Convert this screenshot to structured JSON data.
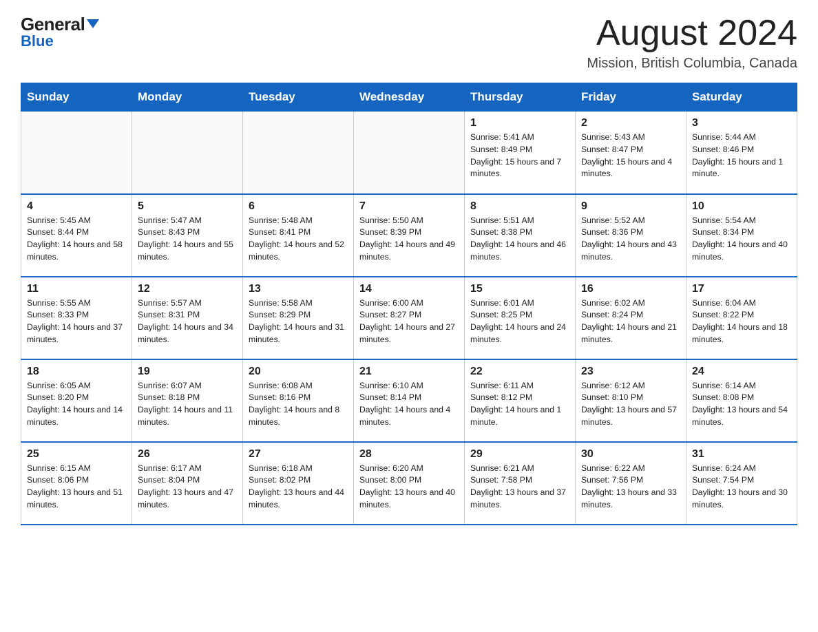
{
  "logo": {
    "top_text": "General",
    "triangle": "▲",
    "bottom_text": "Blue"
  },
  "header": {
    "month_year": "August 2024",
    "location": "Mission, British Columbia, Canada"
  },
  "days_of_week": [
    "Sunday",
    "Monday",
    "Tuesday",
    "Wednesday",
    "Thursday",
    "Friday",
    "Saturday"
  ],
  "weeks": [
    [
      {
        "day": "",
        "info": ""
      },
      {
        "day": "",
        "info": ""
      },
      {
        "day": "",
        "info": ""
      },
      {
        "day": "",
        "info": ""
      },
      {
        "day": "1",
        "info": "Sunrise: 5:41 AM\nSunset: 8:49 PM\nDaylight: 15 hours and 7 minutes."
      },
      {
        "day": "2",
        "info": "Sunrise: 5:43 AM\nSunset: 8:47 PM\nDaylight: 15 hours and 4 minutes."
      },
      {
        "day": "3",
        "info": "Sunrise: 5:44 AM\nSunset: 8:46 PM\nDaylight: 15 hours and 1 minute."
      }
    ],
    [
      {
        "day": "4",
        "info": "Sunrise: 5:45 AM\nSunset: 8:44 PM\nDaylight: 14 hours and 58 minutes."
      },
      {
        "day": "5",
        "info": "Sunrise: 5:47 AM\nSunset: 8:43 PM\nDaylight: 14 hours and 55 minutes."
      },
      {
        "day": "6",
        "info": "Sunrise: 5:48 AM\nSunset: 8:41 PM\nDaylight: 14 hours and 52 minutes."
      },
      {
        "day": "7",
        "info": "Sunrise: 5:50 AM\nSunset: 8:39 PM\nDaylight: 14 hours and 49 minutes."
      },
      {
        "day": "8",
        "info": "Sunrise: 5:51 AM\nSunset: 8:38 PM\nDaylight: 14 hours and 46 minutes."
      },
      {
        "day": "9",
        "info": "Sunrise: 5:52 AM\nSunset: 8:36 PM\nDaylight: 14 hours and 43 minutes."
      },
      {
        "day": "10",
        "info": "Sunrise: 5:54 AM\nSunset: 8:34 PM\nDaylight: 14 hours and 40 minutes."
      }
    ],
    [
      {
        "day": "11",
        "info": "Sunrise: 5:55 AM\nSunset: 8:33 PM\nDaylight: 14 hours and 37 minutes."
      },
      {
        "day": "12",
        "info": "Sunrise: 5:57 AM\nSunset: 8:31 PM\nDaylight: 14 hours and 34 minutes."
      },
      {
        "day": "13",
        "info": "Sunrise: 5:58 AM\nSunset: 8:29 PM\nDaylight: 14 hours and 31 minutes."
      },
      {
        "day": "14",
        "info": "Sunrise: 6:00 AM\nSunset: 8:27 PM\nDaylight: 14 hours and 27 minutes."
      },
      {
        "day": "15",
        "info": "Sunrise: 6:01 AM\nSunset: 8:25 PM\nDaylight: 14 hours and 24 minutes."
      },
      {
        "day": "16",
        "info": "Sunrise: 6:02 AM\nSunset: 8:24 PM\nDaylight: 14 hours and 21 minutes."
      },
      {
        "day": "17",
        "info": "Sunrise: 6:04 AM\nSunset: 8:22 PM\nDaylight: 14 hours and 18 minutes."
      }
    ],
    [
      {
        "day": "18",
        "info": "Sunrise: 6:05 AM\nSunset: 8:20 PM\nDaylight: 14 hours and 14 minutes."
      },
      {
        "day": "19",
        "info": "Sunrise: 6:07 AM\nSunset: 8:18 PM\nDaylight: 14 hours and 11 minutes."
      },
      {
        "day": "20",
        "info": "Sunrise: 6:08 AM\nSunset: 8:16 PM\nDaylight: 14 hours and 8 minutes."
      },
      {
        "day": "21",
        "info": "Sunrise: 6:10 AM\nSunset: 8:14 PM\nDaylight: 14 hours and 4 minutes."
      },
      {
        "day": "22",
        "info": "Sunrise: 6:11 AM\nSunset: 8:12 PM\nDaylight: 14 hours and 1 minute."
      },
      {
        "day": "23",
        "info": "Sunrise: 6:12 AM\nSunset: 8:10 PM\nDaylight: 13 hours and 57 minutes."
      },
      {
        "day": "24",
        "info": "Sunrise: 6:14 AM\nSunset: 8:08 PM\nDaylight: 13 hours and 54 minutes."
      }
    ],
    [
      {
        "day": "25",
        "info": "Sunrise: 6:15 AM\nSunset: 8:06 PM\nDaylight: 13 hours and 51 minutes."
      },
      {
        "day": "26",
        "info": "Sunrise: 6:17 AM\nSunset: 8:04 PM\nDaylight: 13 hours and 47 minutes."
      },
      {
        "day": "27",
        "info": "Sunrise: 6:18 AM\nSunset: 8:02 PM\nDaylight: 13 hours and 44 minutes."
      },
      {
        "day": "28",
        "info": "Sunrise: 6:20 AM\nSunset: 8:00 PM\nDaylight: 13 hours and 40 minutes."
      },
      {
        "day": "29",
        "info": "Sunrise: 6:21 AM\nSunset: 7:58 PM\nDaylight: 13 hours and 37 minutes."
      },
      {
        "day": "30",
        "info": "Sunrise: 6:22 AM\nSunset: 7:56 PM\nDaylight: 13 hours and 33 minutes."
      },
      {
        "day": "31",
        "info": "Sunrise: 6:24 AM\nSunset: 7:54 PM\nDaylight: 13 hours and 30 minutes."
      }
    ]
  ]
}
